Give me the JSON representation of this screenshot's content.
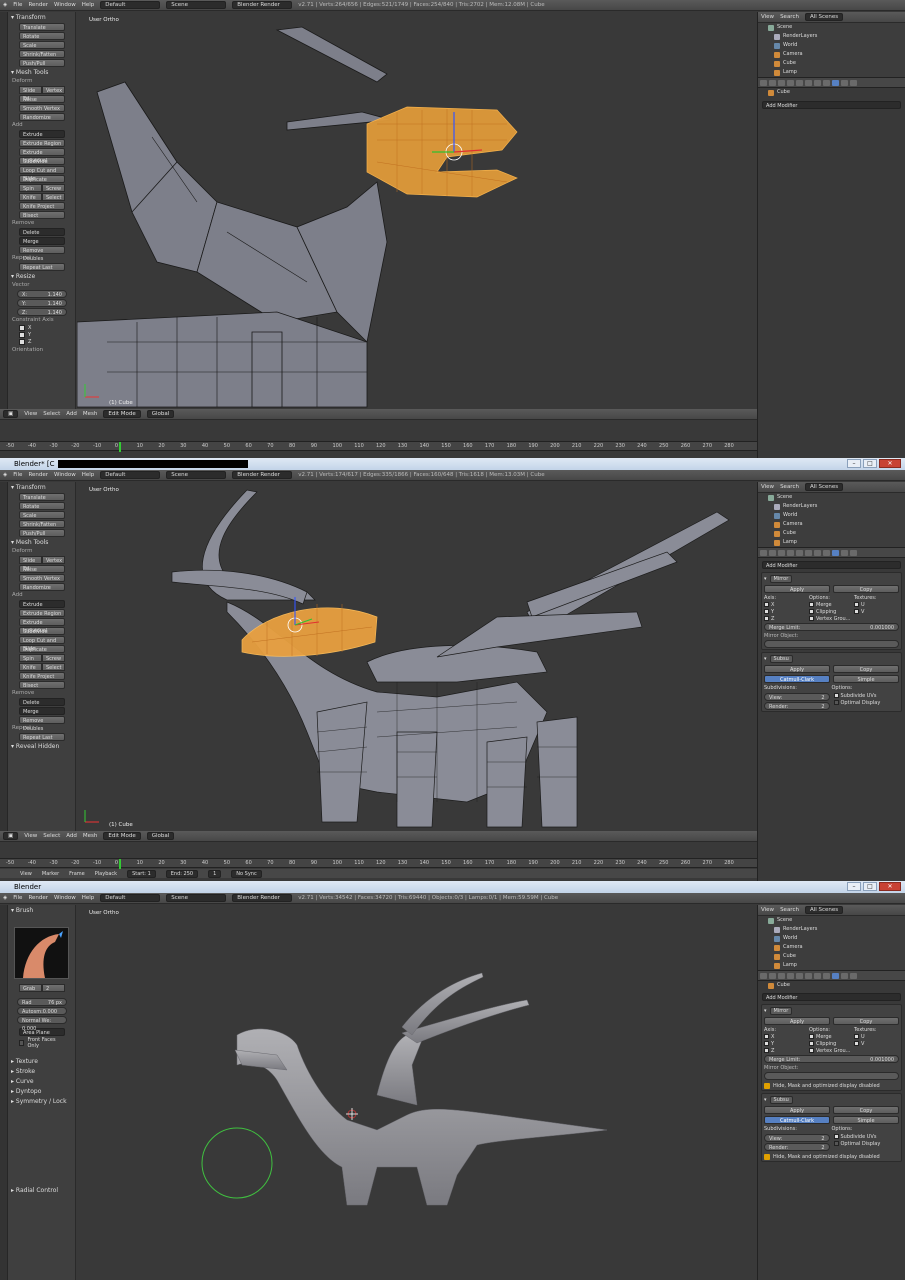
{
  "shot1": {
    "menu": [
      "File",
      "Render",
      "Window",
      "Help"
    ],
    "layout": "Default",
    "scene": "Scene",
    "engine": "Blender Render",
    "stats": "v2.71 | Verts:264/656 | Edges:521/1749 | Faces:254/840 | Tris:2702 | Mem:12.08M | Cube",
    "view_label": "User Ortho",
    "object_label": "(1) Cube",
    "tools": {
      "transform": "Transform",
      "translate": "Translate",
      "rotate": "Rotate",
      "scale": "Scale",
      "shrink": "Shrink/Fatten",
      "pushpull": "Push/Pull",
      "mesh_tools": "Mesh Tools",
      "deform": "Deform",
      "slide_ed": "Slide Ed",
      "vertex": "Vertex",
      "noise": "Noise",
      "smooth": "Smooth Vertex",
      "randomize": "Randomize",
      "add": "Add",
      "extrude": "Extrude",
      "extrude_region": "Extrude Region",
      "extrude_ind": "Extrude Individual",
      "subdivide": "Subdivide",
      "loopcut": "Loop Cut and Slide",
      "duplicate": "Duplicate",
      "spin": "Spin",
      "screw": "Screw",
      "knife": "Knife",
      "select": "Select",
      "knife_project": "Knife Project",
      "bisect": "Bisect",
      "remove": "Remove",
      "delete": "Delete",
      "merge": "Merge",
      "remove_doubles": "Remove Doubles",
      "repeat": "Repeat:",
      "repeat_last": "Repeat Last"
    },
    "resize": {
      "title": "Resize",
      "vector": "Vector",
      "x": "X:",
      "xv": "1.140",
      "y": "Y:",
      "yv": "1.140",
      "z": "Z:",
      "zv": "1.140",
      "constraint": "Constraint Axis",
      "cx": "X",
      "cy": "Y",
      "cz": "Z",
      "orientation": "Orientation"
    },
    "footer": [
      "View",
      "Select",
      "Add",
      "Mesh",
      "Edit Mode",
      "Global"
    ],
    "outliner": {
      "view": "View",
      "search": "Search",
      "all": "All Scenes",
      "scene": "Scene",
      "render": "RenderLayers",
      "world": "World",
      "camera": "Camera",
      "cube": "Cube",
      "lamp": "Lamp"
    },
    "props": {
      "object": "Cube",
      "add_modifier": "Add Modifier"
    },
    "ruler": [
      "-50",
      "-40",
      "-30",
      "-20",
      "-10",
      "0",
      "10",
      "20",
      "30",
      "40",
      "50",
      "60",
      "70",
      "80",
      "90",
      "100",
      "110",
      "120",
      "130",
      "140",
      "150",
      "160",
      "170",
      "180",
      "190",
      "200",
      "210",
      "220",
      "230",
      "240",
      "250",
      "260",
      "270",
      "280"
    ]
  },
  "shot2": {
    "title": "Blender* [C",
    "menu": [
      "File",
      "Render",
      "Window",
      "Help"
    ],
    "layout": "Default",
    "scene": "Scene",
    "engine": "Blender Render",
    "stats": "v2.71 | Verts:174/617 | Edges:335/1866 | Faces:160/648 | Tris:1618 | Mem:13.03M | Cube",
    "view_label": "User Ortho",
    "object_label": "(1) Cube",
    "reveal": "Reveal Hidden",
    "mirror": {
      "name": "Mirror",
      "apply": "Apply",
      "copy": "Copy",
      "axis": "Axis:",
      "options": "Options:",
      "textures": "Textures:",
      "x": "X",
      "y": "Y",
      "z": "Z",
      "merge": "Merge",
      "clipping": "Clipping",
      "vgroups": "Vertex Grou...",
      "u": "U",
      "v": "V",
      "merge_limit": "Merge Limit:",
      "merge_val": "0.001000",
      "mirror_obj": "Mirror Object:"
    },
    "subsurf": {
      "name": "Subsu",
      "apply": "Apply",
      "copy": "Copy",
      "catmull": "Catmull-Clark",
      "simple": "Simple",
      "subdiv": "Subdivisions:",
      "options": "Options:",
      "view": "View:",
      "view_val": "2",
      "render": "Render:",
      "render_val": "2",
      "uvs": "Subdivide UVs",
      "optimal": "Optimal Display"
    },
    "timeline": {
      "view": "View",
      "marker": "Marker",
      "frame": "Frame",
      "playback": "Playback",
      "start": "Start:",
      "start_v": "1",
      "end": "End:",
      "end_v": "250",
      "cur": "1",
      "sync": "No Sync"
    },
    "ruler": [
      "-50",
      "-40",
      "-30",
      "-20",
      "-10",
      "0",
      "10",
      "20",
      "30",
      "40",
      "50",
      "60",
      "70",
      "80",
      "90",
      "100",
      "110",
      "120",
      "130",
      "140",
      "150",
      "160",
      "170",
      "180",
      "190",
      "200",
      "210",
      "220",
      "230",
      "240",
      "250",
      "260",
      "270",
      "280"
    ]
  },
  "shot3": {
    "title": "Blender",
    "menu": [
      "File",
      "Render",
      "Window",
      "Help"
    ],
    "layout": "Default",
    "scene": "Scene",
    "engine": "Blender Render",
    "stats": "v2.71 | Verts:34542 | Faces:34720 | Tris:69440 | Objects:0/3 | Lamps:0/1 | Mem:59.59M | Cube",
    "view_label": "User Ortho",
    "brush": {
      "title": "Brush",
      "grab": "Grab",
      "count": "2",
      "radius": "Rad",
      "radius_v": "76 px",
      "autosmooth": "Autosm:0.000",
      "normal": "Normal We: 0.000",
      "area": "Area Plane",
      "front": "Front Faces Only"
    },
    "panels": [
      "Texture",
      "Stroke",
      "Curve",
      "Dyntopo",
      "Symmetry / Lock"
    ],
    "radial": "Radial Control",
    "warning": "Hide, Mask and optimized display disabled"
  },
  "colors": {
    "accent": "#5680c2",
    "selected": "#f0a030",
    "bg": "#393939"
  }
}
